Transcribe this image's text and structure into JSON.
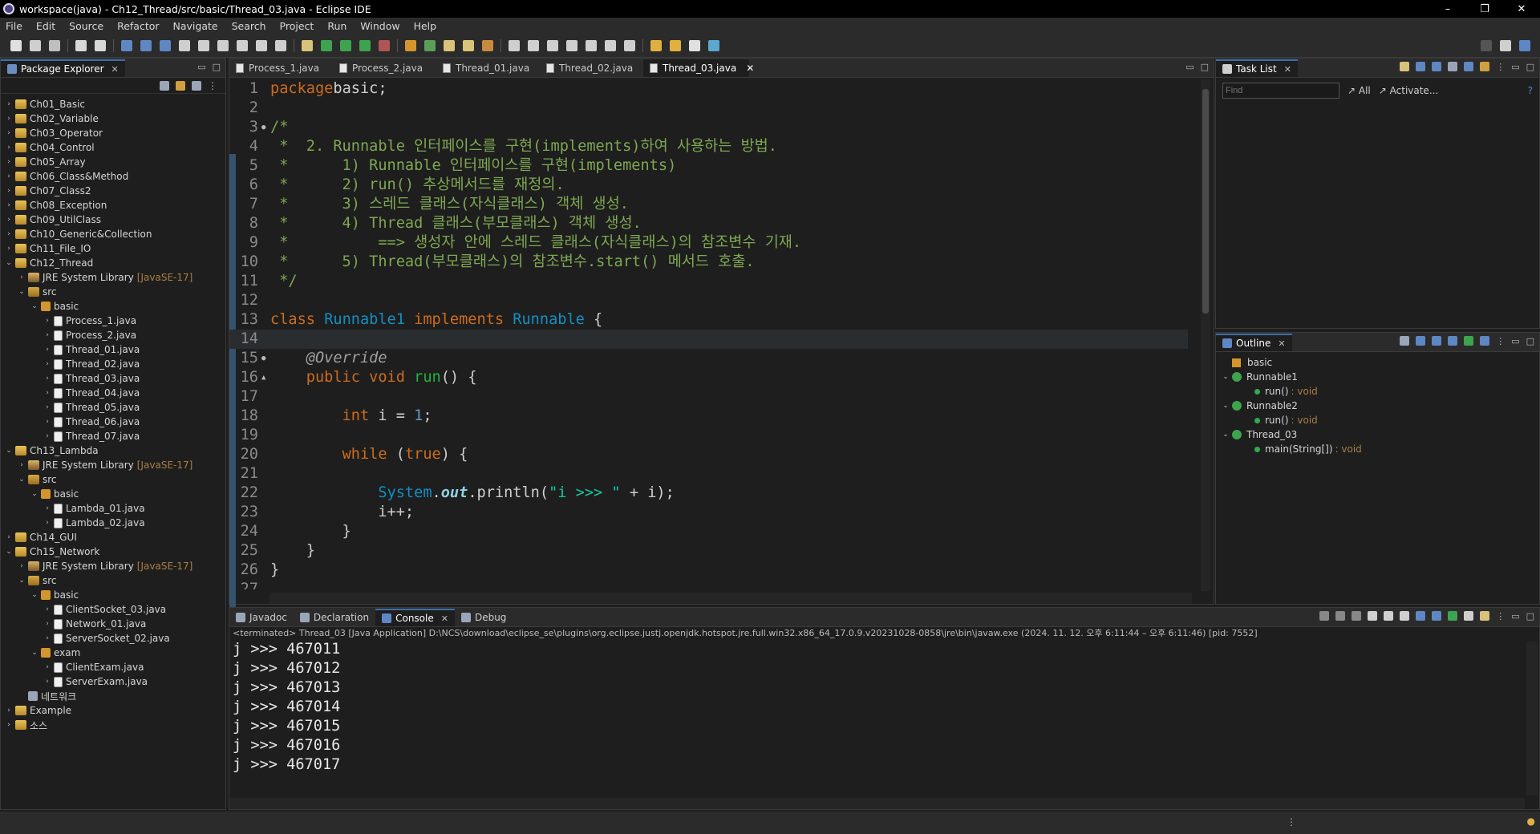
{
  "window": {
    "title": "workspace(java) - Ch12_Thread/src/basic/Thread_03.java - Eclipse IDE",
    "min": "–",
    "max": "❐",
    "close": "✕"
  },
  "menu": [
    "File",
    "Edit",
    "Source",
    "Refactor",
    "Navigate",
    "Search",
    "Project",
    "Run",
    "Window",
    "Help"
  ],
  "package_explorer": {
    "title": "Package Explorer",
    "items": [
      {
        "label": "Ch01_Basic",
        "depth": 0,
        "kind": "proj",
        "open": false
      },
      {
        "label": "Ch02_Variable",
        "depth": 0,
        "kind": "proj",
        "open": false
      },
      {
        "label": "Ch03_Operator",
        "depth": 0,
        "kind": "proj",
        "open": false
      },
      {
        "label": "Ch04_Control",
        "depth": 0,
        "kind": "proj",
        "open": false
      },
      {
        "label": "Ch05_Array",
        "depth": 0,
        "kind": "proj",
        "open": false
      },
      {
        "label": "Ch06_Class&Method",
        "depth": 0,
        "kind": "proj",
        "open": false
      },
      {
        "label": "Ch07_Class2",
        "depth": 0,
        "kind": "proj",
        "open": false
      },
      {
        "label": "Ch08_Exception",
        "depth": 0,
        "kind": "proj",
        "open": false
      },
      {
        "label": "Ch09_UtilClass",
        "depth": 0,
        "kind": "proj",
        "open": false
      },
      {
        "label": "Ch10_Generic&Collection",
        "depth": 0,
        "kind": "proj",
        "open": false
      },
      {
        "label": "Ch11_File_IO",
        "depth": 0,
        "kind": "proj",
        "open": false
      },
      {
        "label": "Ch12_Thread",
        "depth": 0,
        "kind": "proj",
        "open": true
      },
      {
        "label": "JRE System Library",
        "suffix": "[JavaSE-17]",
        "depth": 1,
        "kind": "lib",
        "open": false
      },
      {
        "label": "src",
        "depth": 1,
        "kind": "src",
        "open": true
      },
      {
        "label": "basic",
        "depth": 2,
        "kind": "pkgi",
        "open": true
      },
      {
        "label": "Process_1.java",
        "depth": 3,
        "kind": "file",
        "open": false
      },
      {
        "label": "Process_2.java",
        "depth": 3,
        "kind": "file",
        "open": false
      },
      {
        "label": "Thread_01.java",
        "depth": 3,
        "kind": "file",
        "open": false
      },
      {
        "label": "Thread_02.java",
        "depth": 3,
        "kind": "file",
        "open": false
      },
      {
        "label": "Thread_03.java",
        "depth": 3,
        "kind": "file",
        "open": false
      },
      {
        "label": "Thread_04.java",
        "depth": 3,
        "kind": "file",
        "open": false
      },
      {
        "label": "Thread_05.java",
        "depth": 3,
        "kind": "file",
        "open": false
      },
      {
        "label": "Thread_06.java",
        "depth": 3,
        "kind": "file",
        "open": false
      },
      {
        "label": "Thread_07.java",
        "depth": 3,
        "kind": "file",
        "open": false
      },
      {
        "label": "Ch13_Lambda",
        "depth": 0,
        "kind": "proj",
        "open": true
      },
      {
        "label": "JRE System Library",
        "suffix": "[JavaSE-17]",
        "depth": 1,
        "kind": "lib",
        "open": false
      },
      {
        "label": "src",
        "depth": 1,
        "kind": "src",
        "open": true
      },
      {
        "label": "basic",
        "depth": 2,
        "kind": "pkgi",
        "open": true
      },
      {
        "label": "Lambda_01.java",
        "depth": 3,
        "kind": "file",
        "open": false
      },
      {
        "label": "Lambda_02.java",
        "depth": 3,
        "kind": "file",
        "open": false
      },
      {
        "label": "Ch14_GUI",
        "depth": 0,
        "kind": "proj",
        "open": false
      },
      {
        "label": "Ch15_Network",
        "depth": 0,
        "kind": "proj",
        "open": true
      },
      {
        "label": "JRE System Library",
        "suffix": "[JavaSE-17]",
        "depth": 1,
        "kind": "lib",
        "open": false
      },
      {
        "label": "src",
        "depth": 1,
        "kind": "src",
        "open": true
      },
      {
        "label": "basic",
        "depth": 2,
        "kind": "pkgi",
        "open": true
      },
      {
        "label": "ClientSocket_03.java",
        "depth": 3,
        "kind": "file",
        "open": false
      },
      {
        "label": "Network_01.java",
        "depth": 3,
        "kind": "file",
        "open": false
      },
      {
        "label": "ServerSocket_02.java",
        "depth": 3,
        "kind": "file",
        "open": false
      },
      {
        "label": "exam",
        "depth": 2,
        "kind": "pkgi",
        "open": true
      },
      {
        "label": "ClientExam.java",
        "depth": 3,
        "kind": "file",
        "open": false
      },
      {
        "label": "ServerExam.java",
        "depth": 3,
        "kind": "file",
        "open": false
      },
      {
        "label": "네트워크",
        "depth": 1,
        "kind": "folder",
        "leaf": true
      },
      {
        "label": "Example",
        "depth": 0,
        "kind": "proj",
        "open": false
      },
      {
        "label": "소스",
        "depth": 0,
        "kind": "proj",
        "open": false
      }
    ]
  },
  "editor": {
    "tabs": [
      {
        "label": "Process_1.java",
        "active": false
      },
      {
        "label": "Process_2.java",
        "active": false
      },
      {
        "label": "Thread_01.java",
        "active": false
      },
      {
        "label": "Thread_02.java",
        "active": false
      },
      {
        "label": "Thread_03.java",
        "active": true
      }
    ],
    "lines": [
      {
        "n": "1",
        "tokens": [
          [
            "kw",
            "package"
          ],
          [
            "",
            "basic;"
          ]
        ]
      },
      {
        "n": "2",
        "tokens": []
      },
      {
        "n": "3",
        "marker": "fold",
        "tokens": [
          [
            "cm",
            "/*"
          ]
        ]
      },
      {
        "n": "4",
        "tokens": [
          [
            "cm",
            " *  2. Runnable 인터페이스를 구현(implements)하여 사용하는 방법."
          ]
        ]
      },
      {
        "n": "5",
        "tokens": [
          [
            "cm",
            " *      1) Runnable 인터페이스를 구현(implements)"
          ]
        ]
      },
      {
        "n": "6",
        "tokens": [
          [
            "cm",
            " *      2) run() 추상메서드를 재정의."
          ]
        ]
      },
      {
        "n": "7",
        "tokens": [
          [
            "cm",
            " *      3) 스레드 클래스(자식클래스) 객체 생성."
          ]
        ]
      },
      {
        "n": "8",
        "tokens": [
          [
            "cm",
            " *      4) Thread 클래스(부모클래스) 객체 생성."
          ]
        ]
      },
      {
        "n": "9",
        "tokens": [
          [
            "cm",
            " *          ==> 생성자 안에 스레드 클래스(자식클래스)의 참조변수 기재."
          ]
        ]
      },
      {
        "n": "10",
        "tokens": [
          [
            "cm",
            " *      5) Thread(부모클래스)의 참조변수.start() 메서드 호출."
          ]
        ]
      },
      {
        "n": "11",
        "tokens": [
          [
            "cm",
            " */"
          ]
        ]
      },
      {
        "n": "12",
        "tokens": []
      },
      {
        "n": "13",
        "tokens": [
          [
            "kw",
            "class"
          ],
          [
            "",
            " "
          ],
          [
            "ty",
            "Runnable1"
          ],
          [
            "",
            " "
          ],
          [
            "kw",
            "implements"
          ],
          [
            "",
            " "
          ],
          [
            "ty",
            "Runnable"
          ],
          [
            "",
            " {"
          ]
        ]
      },
      {
        "n": "14",
        "current": true,
        "tokens": []
      },
      {
        "n": "15",
        "marker": "fold",
        "tokens": [
          [
            "",
            "    "
          ],
          [
            "an",
            "@Override"
          ]
        ]
      },
      {
        "n": "16",
        "marker": "override",
        "tokens": [
          [
            "",
            "    "
          ],
          [
            "kw",
            "public"
          ],
          [
            "",
            " "
          ],
          [
            "kw",
            "void"
          ],
          [
            "",
            " "
          ],
          [
            "fn",
            "run"
          ],
          [
            "",
            "() {"
          ]
        ]
      },
      {
        "n": "17",
        "tokens": []
      },
      {
        "n": "18",
        "tokens": [
          [
            "",
            "        "
          ],
          [
            "kw",
            "int"
          ],
          [
            "",
            " i = "
          ],
          [
            "num",
            "1"
          ],
          [
            "",
            ";"
          ]
        ]
      },
      {
        "n": "19",
        "tokens": []
      },
      {
        "n": "20",
        "tokens": [
          [
            "",
            "        "
          ],
          [
            "kw",
            "while"
          ],
          [
            "",
            " ("
          ],
          [
            "kw",
            "true"
          ],
          [
            "",
            ") {"
          ]
        ]
      },
      {
        "n": "21",
        "tokens": []
      },
      {
        "n": "22",
        "tokens": [
          [
            "",
            "            "
          ],
          [
            "ty",
            "System"
          ],
          [
            "",
            "."
          ],
          [
            "fi",
            "out"
          ],
          [
            "",
            ".println("
          ],
          [
            "st",
            "\"i >>> \""
          ],
          [
            "",
            " + i);"
          ]
        ]
      },
      {
        "n": "23",
        "tokens": [
          [
            "",
            "            i++;"
          ]
        ]
      },
      {
        "n": "24",
        "tokens": [
          [
            "",
            "        }"
          ]
        ]
      },
      {
        "n": "25",
        "tokens": [
          [
            "",
            "    }"
          ]
        ]
      },
      {
        "n": "26",
        "tokens": [
          [
            "",
            "}"
          ]
        ]
      },
      {
        "n": "27",
        "tokens": []
      }
    ]
  },
  "task_list": {
    "title": "Task List",
    "find_placeholder": "Find",
    "all_label": "All",
    "activate_label": "Activate..."
  },
  "outline": {
    "title": "Outline",
    "items": [
      {
        "label": "basic",
        "kind": "package",
        "depth": 0
      },
      {
        "label": "Runnable1",
        "kind": "class",
        "depth": 0,
        "open": true
      },
      {
        "label": "run()",
        "ret": ": void",
        "kind": "method",
        "depth": 1
      },
      {
        "label": "Runnable2",
        "kind": "class",
        "depth": 0,
        "open": true
      },
      {
        "label": "run()",
        "ret": ": void",
        "kind": "method",
        "depth": 1
      },
      {
        "label": "Thread_03",
        "kind": "class",
        "depth": 0,
        "open": true
      },
      {
        "label": "main(String[])",
        "ret": ": void",
        "kind": "method",
        "depth": 1
      }
    ]
  },
  "bottom_tabs": [
    {
      "label": "Javadoc",
      "active": false,
      "icon": "at-icon"
    },
    {
      "label": "Declaration",
      "active": false,
      "icon": "declaration-icon"
    },
    {
      "label": "Console",
      "active": true,
      "icon": "console-icon"
    },
    {
      "label": "Debug",
      "active": false,
      "icon": "bug-icon"
    }
  ],
  "console": {
    "info": "<terminated> Thread_03 [Java Application] D:\\NCS\\download\\eclipse_se\\plugins\\org.eclipse.justj.openjdk.hotspot.jre.full.win32.x86_64_17.0.9.v20231028-0858\\jre\\bin\\javaw.exe  (2024. 11. 12. 오후 6:11:44 – 오후 6:11:46) [pid: 7552]",
    "lines": [
      "j >>> 467011",
      "j >>> 467012",
      "j >>> 467013",
      "j >>> 467014",
      "j >>> 467015",
      "j >>> 467016",
      "j >>> 467017"
    ]
  }
}
